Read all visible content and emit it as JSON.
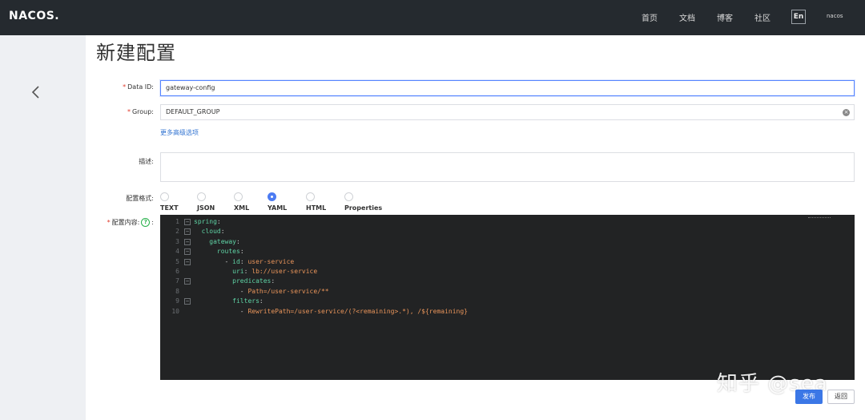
{
  "header": {
    "logo": "NACOS.",
    "nav": [
      "首页",
      "文档",
      "博客",
      "社区"
    ],
    "lang": "En",
    "user": "nacos"
  },
  "page": {
    "title": "新建配置"
  },
  "form": {
    "data_id": {
      "required": "*",
      "label": "Data ID:",
      "value": "gateway-config"
    },
    "group": {
      "required": "*",
      "label": "Group:",
      "value": "DEFAULT_GROUP"
    },
    "advanced_link": "更多高级选项",
    "description": {
      "label": "描述:",
      "value": ""
    },
    "format": {
      "label": "配置格式:",
      "options": [
        "TEXT",
        "JSON",
        "XML",
        "YAML",
        "HTML",
        "Properties"
      ],
      "selected": "YAML"
    },
    "content": {
      "required": "*",
      "label": "配置内容:",
      "help": "?",
      "colon": ":"
    }
  },
  "editor": {
    "lines": [
      {
        "n": "1",
        "fold": true,
        "code": [
          [
            "k",
            "spring"
          ],
          [
            "p",
            ":"
          ]
        ]
      },
      {
        "n": "2",
        "fold": true,
        "code": [
          [
            "p",
            "  "
          ],
          [
            "k",
            "cloud"
          ],
          [
            "p",
            ":"
          ]
        ]
      },
      {
        "n": "3",
        "fold": true,
        "code": [
          [
            "p",
            "    "
          ],
          [
            "k",
            "gateway"
          ],
          [
            "p",
            ":"
          ]
        ]
      },
      {
        "n": "4",
        "fold": true,
        "code": [
          [
            "p",
            "      "
          ],
          [
            "k",
            "routes"
          ],
          [
            "p",
            ":"
          ]
        ]
      },
      {
        "n": "5",
        "fold": true,
        "code": [
          [
            "p",
            "        - "
          ],
          [
            "k",
            "id"
          ],
          [
            "p",
            ": "
          ],
          [
            "v",
            "user-service"
          ]
        ]
      },
      {
        "n": "6",
        "fold": false,
        "code": [
          [
            "p",
            "          "
          ],
          [
            "k",
            "uri"
          ],
          [
            "p",
            ": "
          ],
          [
            "v",
            "lb://user-service"
          ]
        ]
      },
      {
        "n": "7",
        "fold": true,
        "code": [
          [
            "p",
            "          "
          ],
          [
            "k",
            "predicates"
          ],
          [
            "p",
            ":"
          ]
        ]
      },
      {
        "n": "8",
        "fold": false,
        "code": [
          [
            "p",
            "            - "
          ],
          [
            "v",
            "Path=/user-service/**"
          ]
        ]
      },
      {
        "n": "9",
        "fold": true,
        "code": [
          [
            "p",
            "          "
          ],
          [
            "k",
            "filters"
          ],
          [
            "p",
            ":"
          ]
        ]
      },
      {
        "n": "10",
        "fold": false,
        "code": [
          [
            "p",
            "            - "
          ],
          [
            "v",
            "RewritePath=/user-service/(?<remaining>.*), /${remaining}"
          ]
        ]
      }
    ]
  },
  "watermark": "知乎 @sea",
  "actions": {
    "publish": "发布",
    "back": "返回"
  },
  "colors": {
    "topbar": "#252a2f",
    "primary": "#3b77e6",
    "yaml_key": "#5fd3a5",
    "yaml_value": "#e8945a"
  }
}
